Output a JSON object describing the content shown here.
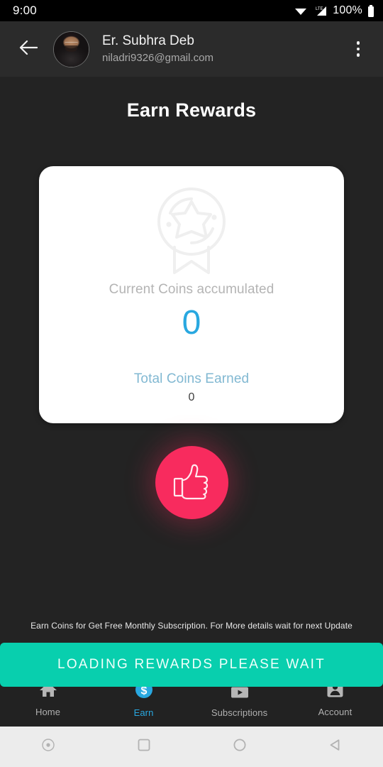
{
  "statusbar": {
    "time": "9:00",
    "battery_percent": "100%",
    "icons": [
      "wifi-icon",
      "lte-signal-icon",
      "battery-icon"
    ]
  },
  "appbar": {
    "back_icon": "back-arrow-icon",
    "avatar_alt": "user-avatar",
    "name": "Er. Subhra Deb",
    "email": "niladri9326@gmail.com",
    "overflow_icon": "more-vertical-icon"
  },
  "page": {
    "title": "Earn Rewards"
  },
  "card": {
    "badge_icon": "award-badge-icon",
    "current_label": "Current Coins accumulated",
    "current_value": "0",
    "total_label": "Total Coins Earned",
    "total_value": "0",
    "value_color": "#29a8e0",
    "total_label_color": "#81b8d2",
    "background": "#ffffff"
  },
  "like": {
    "icon": "thumbs-up-icon",
    "color": "#f82b5e"
  },
  "footer": {
    "note": "Earn Coins for Get Free Monthly Subscription. For More details wait for next Update"
  },
  "cta": {
    "label": "LOADING REWARDS PLEASE WAIT",
    "color": "#08cfae"
  },
  "bottomnav": {
    "active_color": "#29a8e0",
    "items": [
      {
        "label": "Home",
        "icon": "home-icon",
        "active": false
      },
      {
        "label": "Earn",
        "icon": "dollar-coin-icon",
        "active": true
      },
      {
        "label": "Subscriptions",
        "icon": "subscriptions-icon",
        "active": false
      },
      {
        "label": "Account",
        "icon": "account-person-icon",
        "active": false
      }
    ]
  },
  "sysnav": {
    "buttons": [
      {
        "icon": "assistant-dot-icon"
      },
      {
        "icon": "recents-square-icon"
      },
      {
        "icon": "home-circle-icon"
      },
      {
        "icon": "back-triangle-icon"
      }
    ]
  }
}
